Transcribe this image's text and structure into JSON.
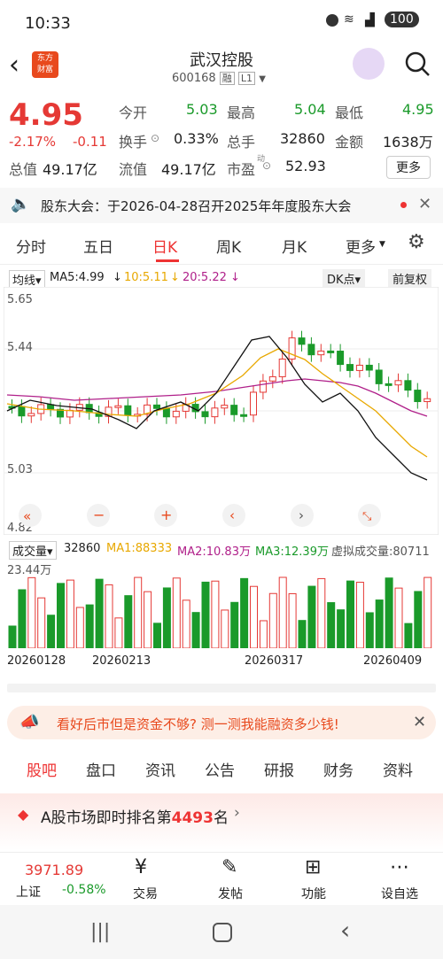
{
  "status": {
    "time": "10:33",
    "battery": "100"
  },
  "header": {
    "title": "武汉控股",
    "code": "600168",
    "badge1": "融",
    "badge2": "L1",
    "logo_line1": "东方",
    "logo_line2": "财富"
  },
  "quote": {
    "price": "4.95",
    "change_pct": "-2.17%",
    "change": "-0.11",
    "open_l": "今开",
    "open": "5.03",
    "high_l": "最高",
    "high": "5.04",
    "low_l": "最低",
    "low": "4.95",
    "turnover_l": "换手",
    "turnover": "0.33%",
    "vol_l": "总手",
    "vol": "32860",
    "amount_l": "金额",
    "amount": "1638万",
    "mcap_l": "总值",
    "mcap": "49.17亿",
    "float_l": "流值",
    "float": "49.17亿",
    "pe_l": "市盈",
    "pe_sup": "动",
    "pe": "52.93",
    "more": "更多"
  },
  "notice": {
    "text": "股东大会：于2026-04-28召开2025年年度股东大会"
  },
  "tabs": [
    "分时",
    "五日",
    "日K",
    "周K",
    "月K",
    "更多"
  ],
  "ma": {
    "sel": "均线",
    "ma5": "MA5:4.99",
    "ma10": "10:5.11",
    "ma20": "20:5.22",
    "dk": "DK点",
    "fq": "前复权"
  },
  "chart_data": {
    "type": "candlestick",
    "ylabels": [
      "5.65",
      "5.44",
      "5.03",
      "4.82"
    ],
    "vol_label": "23.44万",
    "x": [
      "20260128",
      "20260213",
      "20260317",
      "20260409"
    ]
  },
  "volrow": {
    "sel": "成交量",
    "v": "32860",
    "ma1": "MA1:88333",
    "ma2": "MA2:10.83万",
    "ma3": "MA3:12.39万",
    "virt": "虚拟成交量:80711"
  },
  "ad": {
    "text": "看好后市但是资金不够? 测一测我能融资多少钱!"
  },
  "bottabs": [
    "股吧",
    "盘口",
    "资讯",
    "公告",
    "研报",
    "财务",
    "资料"
  ],
  "rank": {
    "pre": "A股市场即时排名第",
    "num": "4493",
    "post": "名"
  },
  "bottomnav": {
    "index": "3971.89",
    "index_name": "上证",
    "index_chg": "-0.58%",
    "items": [
      "交易",
      "发帖",
      "功能",
      "设自选"
    ]
  },
  "colors": {
    "up": "#e53935",
    "down": "#1a9a2a",
    "accent": "#ff5722"
  }
}
